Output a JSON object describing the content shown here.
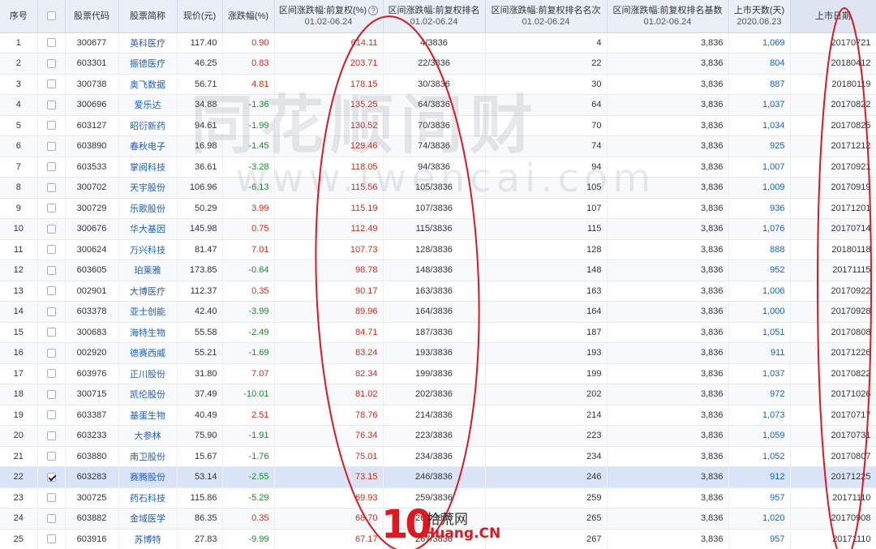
{
  "headers": {
    "seq": "序号",
    "code": "股票代码",
    "name": "股票简称",
    "price": "现价(元)",
    "change": "涨跌幅(%)",
    "range_change": "区间涨跌幅:前复权(%)",
    "range_change_sub": "01.02-06.24",
    "help_icon": "?",
    "rank": "区间涨跌幅:前复权排名",
    "rank_sub": "01.02-06.24",
    "rank_order": "区间涨跌幅:前复权排名名次",
    "rank_order_sub": "01.02-06.24",
    "rank_base": "区间涨跌幅:前复权排名基数",
    "rank_base_sub": "01.02-06.24",
    "days": "上市天数(天)",
    "days_sub": "2020.06.23",
    "list_date": "上市日期"
  },
  "rows": [
    {
      "seq": "1",
      "checked": false,
      "code": "300677",
      "name": "英科医疗",
      "price": "117.40",
      "change": "0.90",
      "range": "614.11",
      "rank": "4/3836",
      "order": "4",
      "base": "3,836",
      "days": "1,069",
      "date": "20170721"
    },
    {
      "seq": "2",
      "checked": false,
      "code": "603301",
      "name": "振德医疗",
      "price": "46.25",
      "change": "0.83",
      "range": "203.71",
      "rank": "22/3836",
      "order": "22",
      "base": "3,836",
      "days": "804",
      "date": "20180412"
    },
    {
      "seq": "3",
      "checked": false,
      "code": "300738",
      "name": "奥飞数据",
      "price": "56.71",
      "change": "4.81",
      "range": "178.15",
      "rank": "30/3836",
      "order": "30",
      "base": "3,836",
      "days": "887",
      "date": "20180119"
    },
    {
      "seq": "4",
      "checked": false,
      "code": "300696",
      "name": "爱乐达",
      "price": "34.88",
      "change": "-1.36",
      "range": "135.25",
      "rank": "64/3836",
      "order": "64",
      "base": "3,836",
      "days": "1,037",
      "date": "20170822"
    },
    {
      "seq": "5",
      "checked": false,
      "code": "603127",
      "name": "昭衍新药",
      "price": "94.61",
      "change": "-1.99",
      "range": "130.52",
      "rank": "70/3836",
      "order": "70",
      "base": "3,836",
      "days": "1,034",
      "date": "20170825"
    },
    {
      "seq": "6",
      "checked": false,
      "code": "603890",
      "name": "春秋电子",
      "price": "16.98",
      "change": "-1.45",
      "range": "129.46",
      "rank": "74/3836",
      "order": "74",
      "base": "3,836",
      "days": "925",
      "date": "20171212"
    },
    {
      "seq": "7",
      "checked": false,
      "code": "603533",
      "name": "掌阅科技",
      "price": "36.61",
      "change": "-3.28",
      "range": "118.05",
      "rank": "94/3836",
      "order": "94",
      "base": "3,836",
      "days": "1,007",
      "date": "20170921"
    },
    {
      "seq": "8",
      "checked": false,
      "code": "300702",
      "name": "天宇股份",
      "price": "106.96",
      "change": "-6.13",
      "range": "115.56",
      "rank": "105/3836",
      "order": "105",
      "base": "3,836",
      "days": "1,009",
      "date": "20170919"
    },
    {
      "seq": "9",
      "checked": false,
      "code": "300729",
      "name": "乐歌股份",
      "price": "50.29",
      "change": "3.99",
      "range": "115.19",
      "rank": "107/3836",
      "order": "107",
      "base": "3,836",
      "days": "936",
      "date": "20171201"
    },
    {
      "seq": "10",
      "checked": false,
      "code": "300676",
      "name": "华大基因",
      "price": "145.98",
      "change": "0.75",
      "range": "112.49",
      "rank": "115/3836",
      "order": "115",
      "base": "3,836",
      "days": "1,076",
      "date": "20170714"
    },
    {
      "seq": "11",
      "checked": false,
      "code": "300624",
      "name": "万兴科技",
      "price": "81.47",
      "change": "7.01",
      "range": "107.73",
      "rank": "128/3836",
      "order": "128",
      "base": "3,836",
      "days": "888",
      "date": "20180118"
    },
    {
      "seq": "12",
      "checked": false,
      "code": "603605",
      "name": "珀莱雅",
      "price": "173.85",
      "change": "-0.64",
      "range": "98.78",
      "rank": "148/3836",
      "order": "148",
      "base": "3,836",
      "days": "952",
      "date": "20171115"
    },
    {
      "seq": "13",
      "checked": false,
      "code": "002901",
      "name": "大博医疗",
      "price": "112.37",
      "change": "0.35",
      "range": "90.17",
      "rank": "163/3836",
      "order": "163",
      "base": "3,836",
      "days": "1,006",
      "date": "20170922"
    },
    {
      "seq": "14",
      "checked": false,
      "code": "603378",
      "name": "亚士创能",
      "price": "42.40",
      "change": "-3.99",
      "range": "89.96",
      "rank": "164/3836",
      "order": "164",
      "base": "3,836",
      "days": "1,000",
      "date": "20170928"
    },
    {
      "seq": "15",
      "checked": false,
      "code": "300683",
      "name": "海特生物",
      "price": "55.58",
      "change": "-2.49",
      "range": "84.71",
      "rank": "187/3836",
      "order": "187",
      "base": "3,836",
      "days": "1,051",
      "date": "20170808"
    },
    {
      "seq": "16",
      "checked": false,
      "code": "002920",
      "name": "德赛西威",
      "price": "55.21",
      "change": "-1.69",
      "range": "83.24",
      "rank": "193/3836",
      "order": "193",
      "base": "3,836",
      "days": "911",
      "date": "20171226"
    },
    {
      "seq": "17",
      "checked": false,
      "code": "603976",
      "name": "正川股份",
      "price": "31.80",
      "change": "7.07",
      "range": "82.34",
      "rank": "199/3836",
      "order": "199",
      "base": "3,836",
      "days": "1,037",
      "date": "20170822"
    },
    {
      "seq": "18",
      "checked": false,
      "code": "300715",
      "name": "凯伦股份",
      "price": "37.49",
      "change": "-10.01",
      "range": "81.02",
      "rank": "202/3836",
      "order": "202",
      "base": "3,836",
      "days": "972",
      "date": "20171026"
    },
    {
      "seq": "19",
      "checked": false,
      "code": "603387",
      "name": "基蛋生物",
      "price": "40.49",
      "change": "2.51",
      "range": "78.76",
      "rank": "214/3836",
      "order": "214",
      "base": "3,836",
      "days": "1,073",
      "date": "20170717"
    },
    {
      "seq": "20",
      "checked": false,
      "code": "603233",
      "name": "大参林",
      "price": "75.90",
      "change": "-1.91",
      "range": "76.34",
      "rank": "223/3836",
      "order": "223",
      "base": "3,836",
      "days": "1,059",
      "date": "20170731"
    },
    {
      "seq": "21",
      "checked": false,
      "code": "603880",
      "name": "南卫股份",
      "price": "15.67",
      "change": "-1.76",
      "range": "75.01",
      "rank": "234/3836",
      "order": "234",
      "base": "3,836",
      "days": "1,052",
      "date": "20170807"
    },
    {
      "seq": "22",
      "checked": true,
      "code": "603283",
      "name": "赛腾股份",
      "price": "53.14",
      "change": "-2.55",
      "range": "73.15",
      "rank": "246/3836",
      "order": "246",
      "base": "3,836",
      "days": "912",
      "date": "20171225"
    },
    {
      "seq": "23",
      "checked": false,
      "code": "300725",
      "name": "药石科技",
      "price": "115.86",
      "change": "-5.29",
      "range": "69.93",
      "rank": "259/3836",
      "order": "259",
      "base": "3,836",
      "days": "957",
      "date": "20171110"
    },
    {
      "seq": "24",
      "checked": false,
      "code": "603882",
      "name": "金域医学",
      "price": "86.35",
      "change": "0.35",
      "range": "68.70",
      "rank": "265/3836",
      "order": "265",
      "base": "3,836",
      "days": "1,020",
      "date": "20170908"
    },
    {
      "seq": "25",
      "checked": false,
      "code": "603916",
      "name": "苏博特",
      "price": "27.83",
      "change": "-9.99",
      "range": "67.17",
      "rank": "267/3836",
      "order": "267",
      "base": "3,836",
      "days": "957",
      "date": "20171110"
    }
  ],
  "watermark": {
    "cn": "同花顺问财",
    "en": "www.iwencai.com"
  },
  "logo": {
    "num": "10",
    "cn": "拾荒网",
    "en": "Huang.CN"
  },
  "colors": {
    "header_bg": "#e9eef7",
    "up": "#e0271b",
    "down": "#1c8a2c",
    "link": "#1a5ecc",
    "selected_row": "#d9e5f7",
    "annotation": "#e0171e"
  }
}
